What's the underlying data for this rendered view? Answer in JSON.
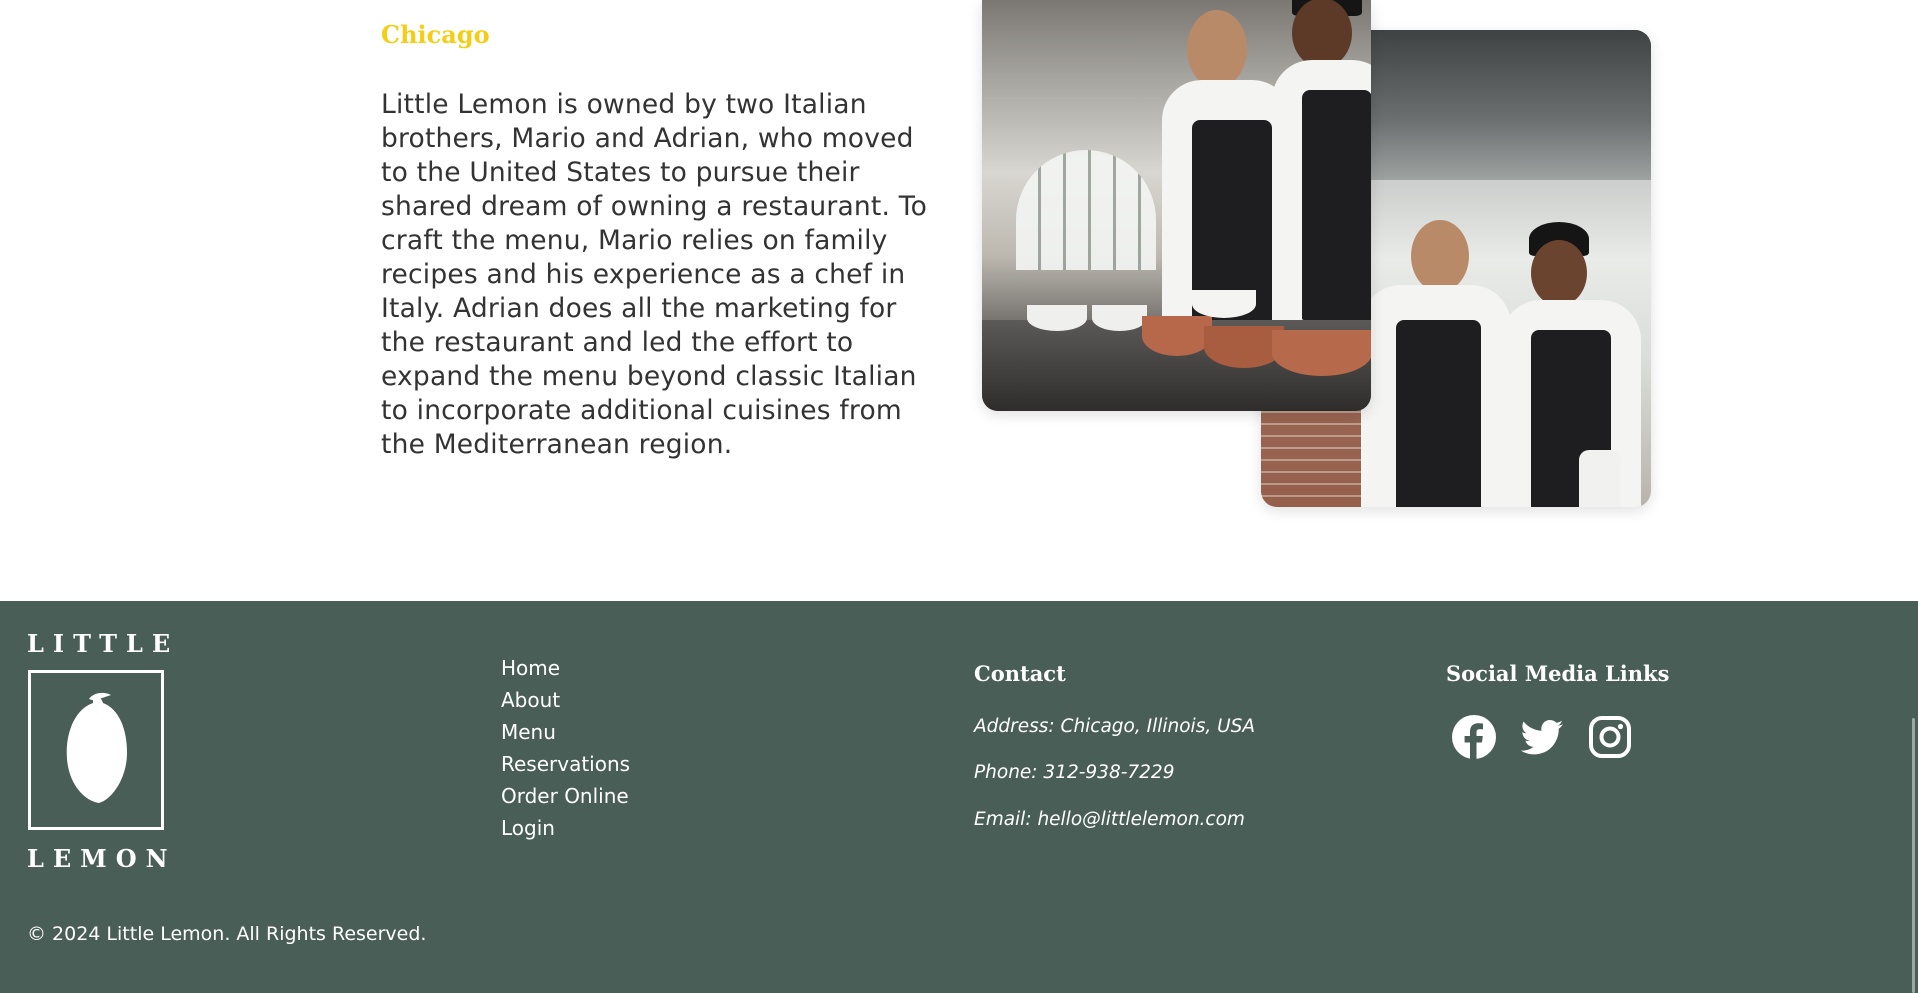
{
  "about": {
    "city": "Chicago",
    "story": "Little Lemon is owned by two Italian brothers, Mario and Adrian, who moved to the United States to pursue their shared dream of owning a restaurant. To craft the menu, Mario relies on family recipes and his experience as a chef in Italy. Adrian does all the marketing for the restaurant and led the effort to expand the menu beyond classic Italian to incorporate additional cuisines from the Mediterranean region."
  },
  "footer": {
    "logo": {
      "top": "LITTLE",
      "bottom": "LEMON"
    },
    "nav": [
      "Home",
      "About",
      "Menu",
      "Reservations",
      "Order Online",
      "Login"
    ],
    "contact": {
      "heading": "Contact",
      "address": "Address: Chicago, Illinois, USA",
      "phone": "Phone: 312-938-7229",
      "email": "Email: hello@littlelemon.com"
    },
    "social": {
      "heading": "Social Media Links",
      "icons": [
        "facebook-icon",
        "twitter-icon",
        "instagram-icon"
      ]
    },
    "copyright": "© 2024 Little Lemon. All Rights Reserved."
  },
  "colors": {
    "footer_bg": "#495E57",
    "accent_yellow": "#F4CE14",
    "text_dark": "#333333",
    "text_light": "#FFFFFF"
  }
}
